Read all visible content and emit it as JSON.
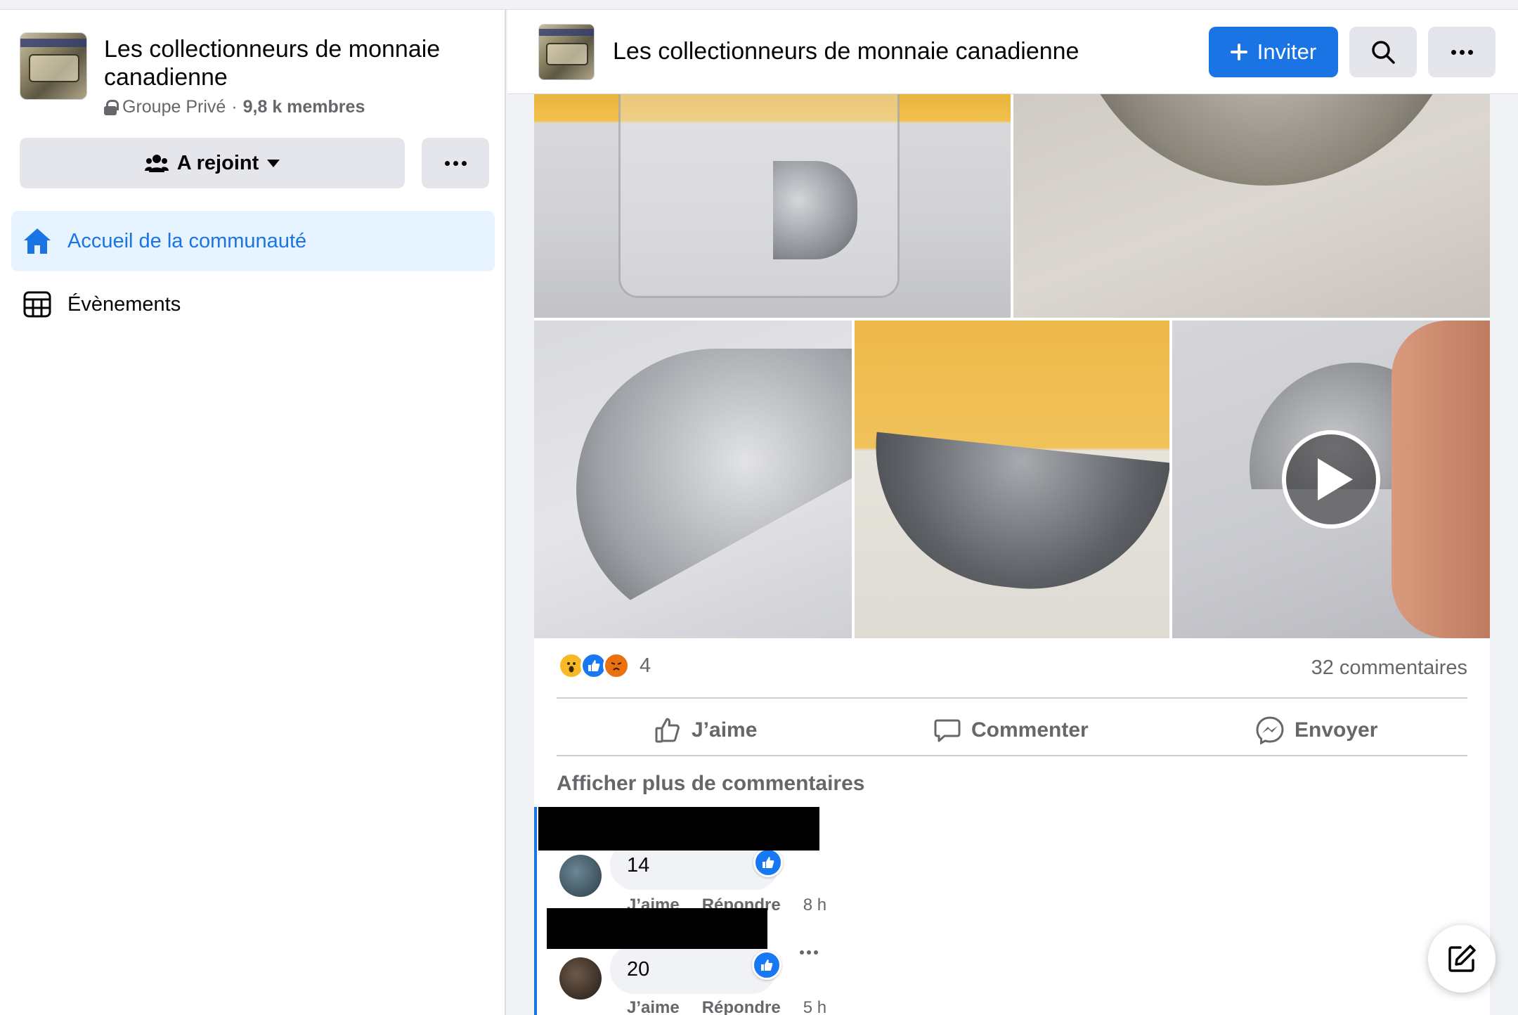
{
  "group": {
    "name": "Les collectionneurs de monnaie canadienne",
    "privacy": "Groupe Privé",
    "separator": "·",
    "members": "9,8 k membres"
  },
  "sidebar": {
    "joined_label": "A rejoint",
    "nav": [
      {
        "label": "Accueil de la communauté",
        "icon": "home-icon",
        "active": true
      },
      {
        "label": "Évènements",
        "icon": "calendar-icon",
        "active": false
      }
    ]
  },
  "header": {
    "title": "Les collectionneurs de monnaie canadienne",
    "invite_label": "Inviter"
  },
  "post": {
    "reaction_count": "4",
    "reactions": [
      "wow",
      "like",
      "angry"
    ],
    "comments_count": "32 commentaires",
    "actions": {
      "like": "J’aime",
      "comment": "Commenter",
      "send": "Envoyer"
    },
    "more_comments": "Afficher plus de commentaires",
    "comments": [
      {
        "text": "14",
        "like": "J’aime",
        "reply": "Répondre",
        "time": "8 h"
      },
      {
        "text": "20",
        "like": "J’aime",
        "reply": "Répondre",
        "time": "5 h"
      }
    ]
  },
  "colors": {
    "accent": "#1b74e4",
    "secondary_text": "#65676b",
    "active_nav_bg": "#e7f3ff",
    "button_bg": "#e4e6eb"
  }
}
